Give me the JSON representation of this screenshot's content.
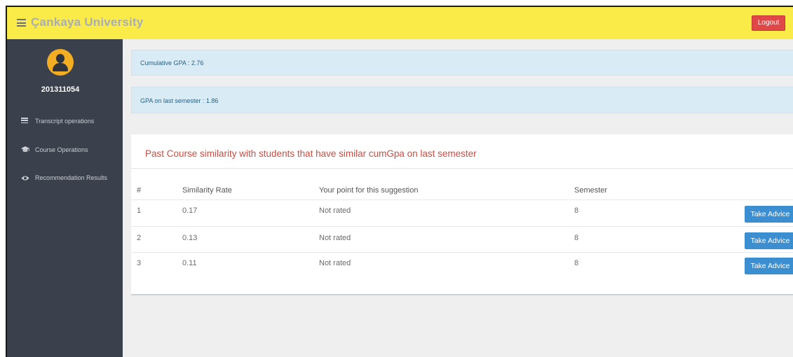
{
  "header": {
    "brand": "Çankaya University",
    "logout_label": "Logout"
  },
  "sidebar": {
    "student_id": "201311054",
    "items": [
      {
        "label": "Transcript operations",
        "icon": "menu-lines-icon"
      },
      {
        "label": "Course Operations",
        "icon": "graduation-cap-icon"
      },
      {
        "label": "Recommendation Results",
        "icon": "eye-icon"
      }
    ]
  },
  "cards": [
    {
      "text": "Cumulative GPA : 2.76"
    },
    {
      "text": "GPA on last semester : 1.86"
    }
  ],
  "panel": {
    "title": "Past Course similarity with students that have similar cumGpa on last semester",
    "headers": [
      "#",
      "Similarity Rate",
      "Your point for this suggestion",
      "Semester"
    ],
    "rows": [
      {
        "index": "1",
        "rate": "0.17",
        "point": "Not rated",
        "semester": "8",
        "action": "Take Advice"
      },
      {
        "index": "2",
        "rate": "0.13",
        "point": "Not rated",
        "semester": "8",
        "action": "Take Advice"
      },
      {
        "index": "3",
        "rate": "0.11",
        "point": "Not rated",
        "semester": "8",
        "action": "Take Advice"
      }
    ]
  },
  "colors": {
    "topbar": "#fbeb49",
    "sidebar": "#3b414c",
    "accent_red": "#d34a3f",
    "button_blue": "#3b8fd1",
    "logout_red": "#e04848",
    "info_card": "#d9ecf6"
  }
}
